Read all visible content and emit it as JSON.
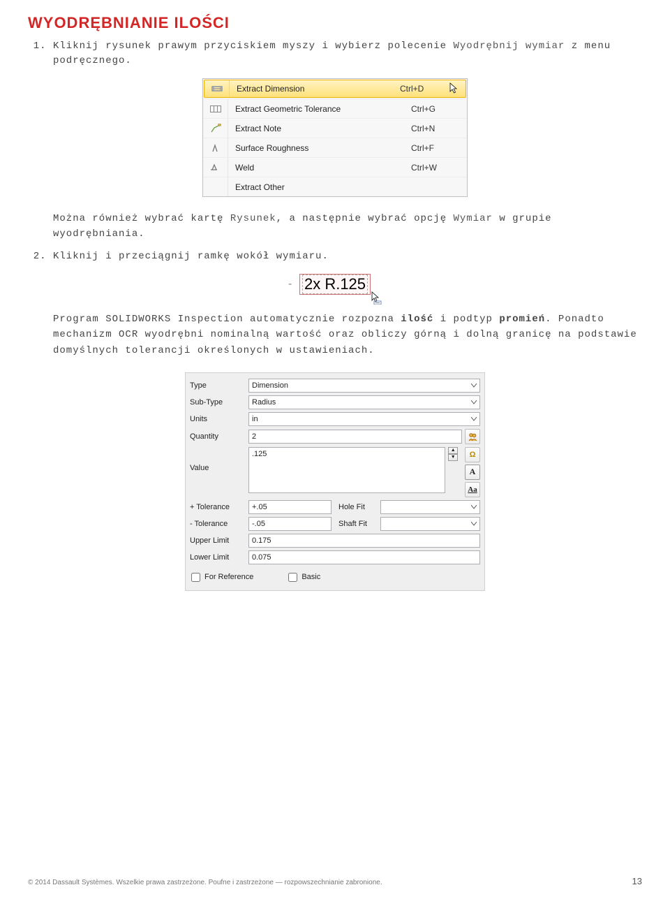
{
  "heading": "WYODRĘBNIANIE ILOŚCI",
  "step1_pre": "Kliknij rysunek prawym przyciskiem myszy i wybierz polecenie ",
  "step1_ui": "Wyodrębnij wymiar",
  "step1_post": " z menu podręcznego.",
  "contextMenu": {
    "items": [
      {
        "label": "Extract Dimension",
        "shortcut": "Ctrl+D",
        "highlight": true,
        "icon": "dim"
      },
      {
        "label": "Extract Geometric Tolerance",
        "shortcut": "Ctrl+G",
        "highlight": false,
        "icon": "gt"
      },
      {
        "label": "Extract Note",
        "shortcut": "Ctrl+N",
        "highlight": false,
        "icon": "note"
      },
      {
        "label": "Surface Roughness",
        "shortcut": "Ctrl+F",
        "highlight": false,
        "icon": "surf"
      },
      {
        "label": "Weld",
        "shortcut": "Ctrl+W",
        "highlight": false,
        "icon": "weld"
      },
      {
        "label": "Extract Other",
        "shortcut": "",
        "highlight": false,
        "icon": ""
      }
    ]
  },
  "para_after_menu_pre": "Można również wybrać kartę ",
  "para_after_menu_ui1": "Rysunek",
  "para_after_menu_mid": ", a następnie wybrać opcję ",
  "para_after_menu_ui2": "Wymiar",
  "para_after_menu_post": " w grupie wyodrębniania.",
  "step2": "Kliknij i przeciągnij ramkę wokół wymiaru.",
  "selection_text": "2x R.125",
  "para_after_sel_pre": "Program SOLIDWORKS Inspection automatycznie rozpozna ",
  "para_after_sel_b1": "ilość",
  "para_after_sel_mid": " i podtyp ",
  "para_after_sel_b2": "promień",
  "para_after_sel_post": ". Ponadto mechanizm OCR wyodrębni nominalną wartość oraz obliczy górną i dolną granicę na podstawie domyślnych tolerancji określonych w ustawieniach.",
  "panel": {
    "typeLabel": "Type",
    "typeValue": "Dimension",
    "subTypeLabel": "Sub-Type",
    "subTypeValue": "Radius",
    "unitsLabel": "Units",
    "unitsValue": "in",
    "quantityLabel": "Quantity",
    "quantityValue": "2",
    "valueLabel": "Value",
    "valueValue": ".125",
    "plusTolLabel": "+ Tolerance",
    "plusTolValue": "+.05",
    "holeFitLabel": "Hole Fit",
    "holeFitValue": "",
    "minusTolLabel": "- Tolerance",
    "minusTolValue": "-.05",
    "shaftFitLabel": "Shaft Fit",
    "shaftFitValue": "",
    "upperLabel": "Upper Limit",
    "upperValue": "0.175",
    "lowerLabel": "Lower Limit",
    "lowerValue": "0.075",
    "forRefLabel": "For Reference",
    "basicLabel": "Basic"
  },
  "footer_left": "© 2014 Dassault Systèmes. Wszelkie prawa zastrzeżone. Poufne i zastrzeżone — rozpowszechnianie zabronione.",
  "footer_page": "13"
}
